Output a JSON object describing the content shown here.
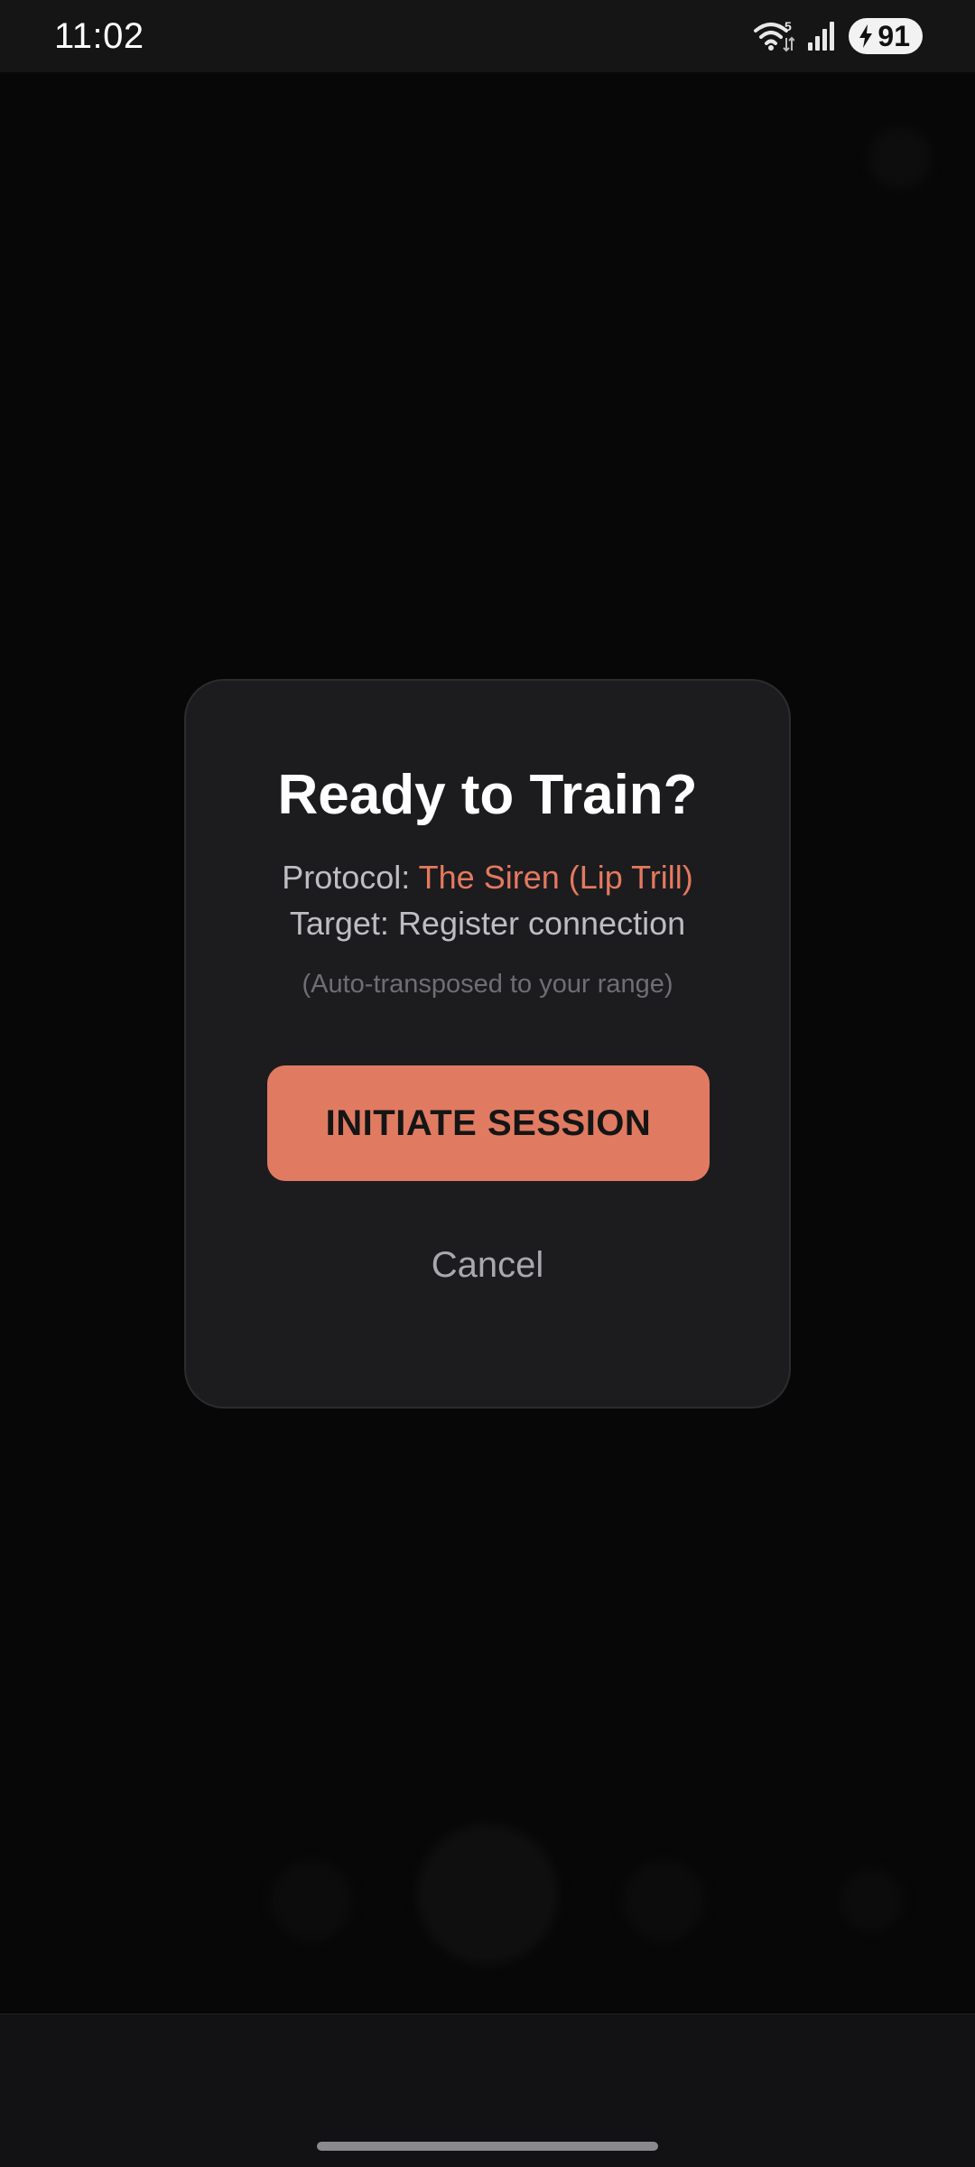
{
  "status_bar": {
    "time": "11:02",
    "battery_level": "91",
    "wifi_badge": "5",
    "icons": [
      "wifi-icon",
      "signal-icon",
      "battery-charging-icon"
    ]
  },
  "modal": {
    "title": "Ready to Train?",
    "protocol_label": "Protocol: ",
    "protocol_value": "The Siren (Lip Trill)",
    "target_text": "Target: Register connection",
    "note": "(Auto-transposed to your range)",
    "primary_button": "INITIATE SESSION",
    "cancel_button": "Cancel"
  },
  "colors": {
    "accent": "#e07b62",
    "modal_background": "#1c1c1f",
    "screen_background": "#0b0b0c"
  }
}
